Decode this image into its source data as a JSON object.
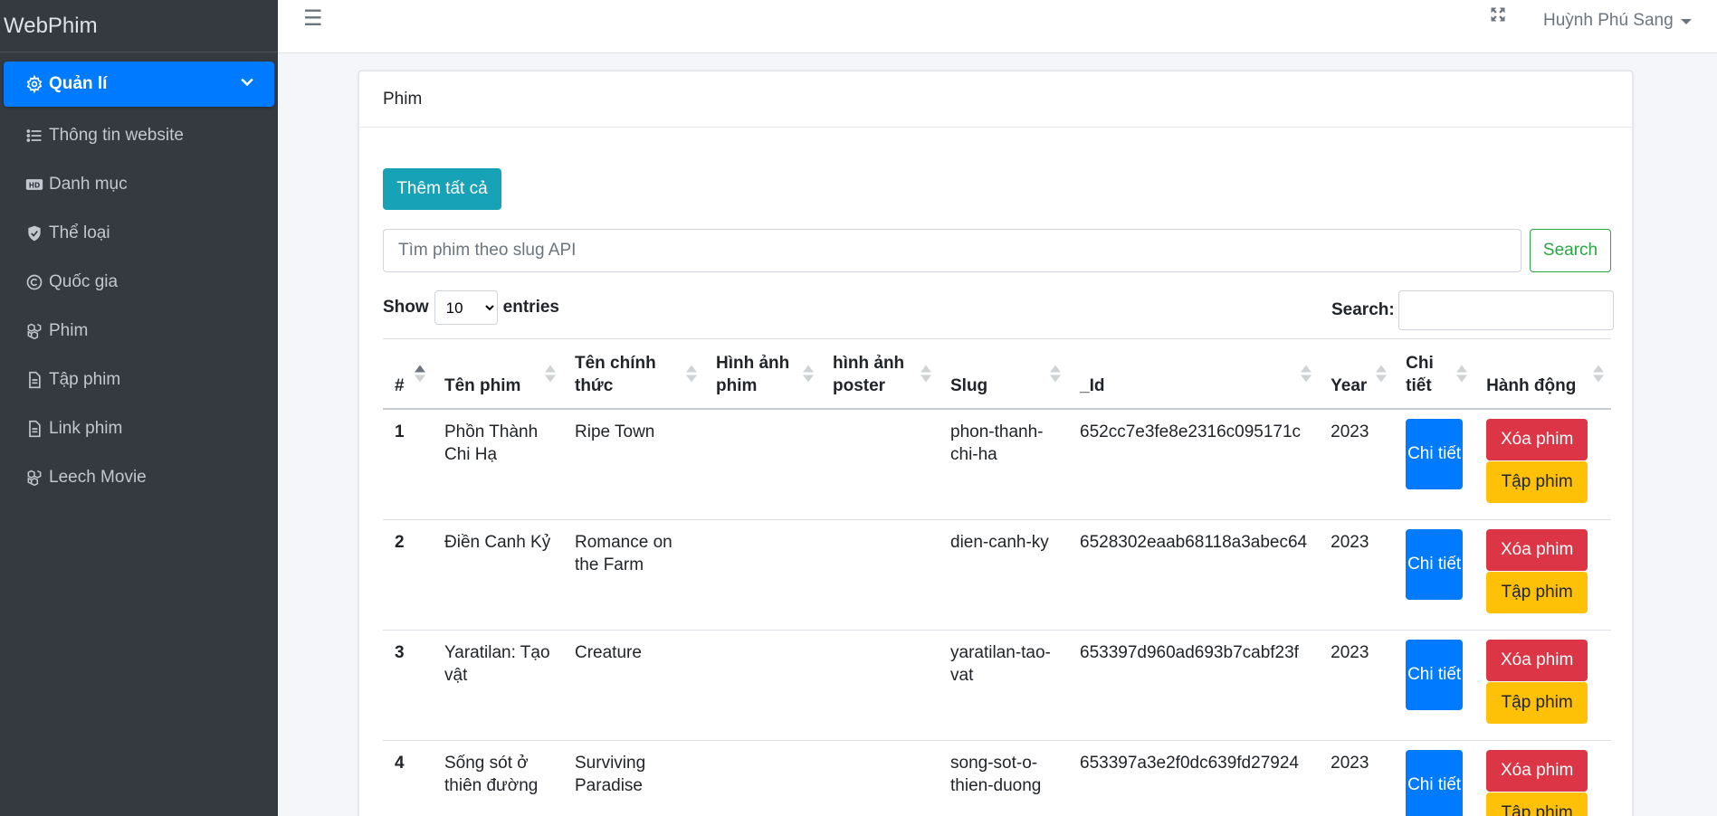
{
  "brand": "WebPhim",
  "sidebar": {
    "items": [
      {
        "label": "Quản lí",
        "icon": "gear-icon",
        "active": true
      },
      {
        "label": "Thông tin website",
        "icon": "list-icon"
      },
      {
        "label": "Danh mục",
        "icon": "hd-icon"
      },
      {
        "label": "Thể loại",
        "icon": "shield-icon"
      },
      {
        "label": "Quốc gia",
        "icon": "copyright-icon"
      },
      {
        "label": "Phim",
        "icon": "cubes-icon"
      },
      {
        "label": "Tập phim",
        "icon": "file-icon"
      },
      {
        "label": "Link phim",
        "icon": "file-icon"
      },
      {
        "label": "Leech Movie",
        "icon": "cubes-icon"
      }
    ]
  },
  "topbar": {
    "user_name": "Huỳnh Phú Sang"
  },
  "card": {
    "title": "Phim",
    "add_all_label": "Thêm tất cả",
    "api_search_placeholder": "Tìm phim theo slug API",
    "api_search_button": "Search",
    "show_label": "Show",
    "entries_label": "entries",
    "page_length": "10",
    "filter_label": "Search:"
  },
  "table": {
    "headers": [
      "#",
      "Tên phim",
      "Tên chính thức",
      "Hình ảnh phim",
      "hình ảnh poster",
      "Slug",
      "_Id",
      "Year",
      "Chi tiết",
      "Hành động"
    ],
    "detail_label": "Chi tiết",
    "delete_label": "Xóa phim",
    "episodes_label": "Tập phim",
    "rows": [
      {
        "idx": "1",
        "name": "Phồn Thành Chi Hạ",
        "origin": "Ripe Town",
        "slug": "phon-thanh-chi-ha",
        "id": "652cc7e3fe8e2316c095171c",
        "year": "2023"
      },
      {
        "idx": "2",
        "name": "Điền Canh Kỷ",
        "origin": "Romance on the Farm",
        "slug": "dien-canh-ky",
        "id": "6528302eaab68118a3abec64",
        "year": "2023"
      },
      {
        "idx": "3",
        "name": "Yaratilan: Tạo vật",
        "origin": "Creature",
        "slug": "yaratilan-tao-vat",
        "id": "653397d960ad693b7cabf23f",
        "year": "2023"
      },
      {
        "idx": "4",
        "name": "Sống sót ở thiên đường",
        "origin": "Surviving Paradise",
        "slug": "song-sot-o-thien-duong",
        "id": "653397a3e2f0dc639fd27924",
        "year": "2023"
      }
    ]
  },
  "colors": {
    "sidebar_bg": "#343a40",
    "primary": "#007bff",
    "info": "#17a2b8",
    "success": "#28a745",
    "danger": "#dc3545",
    "warning": "#ffc107"
  }
}
